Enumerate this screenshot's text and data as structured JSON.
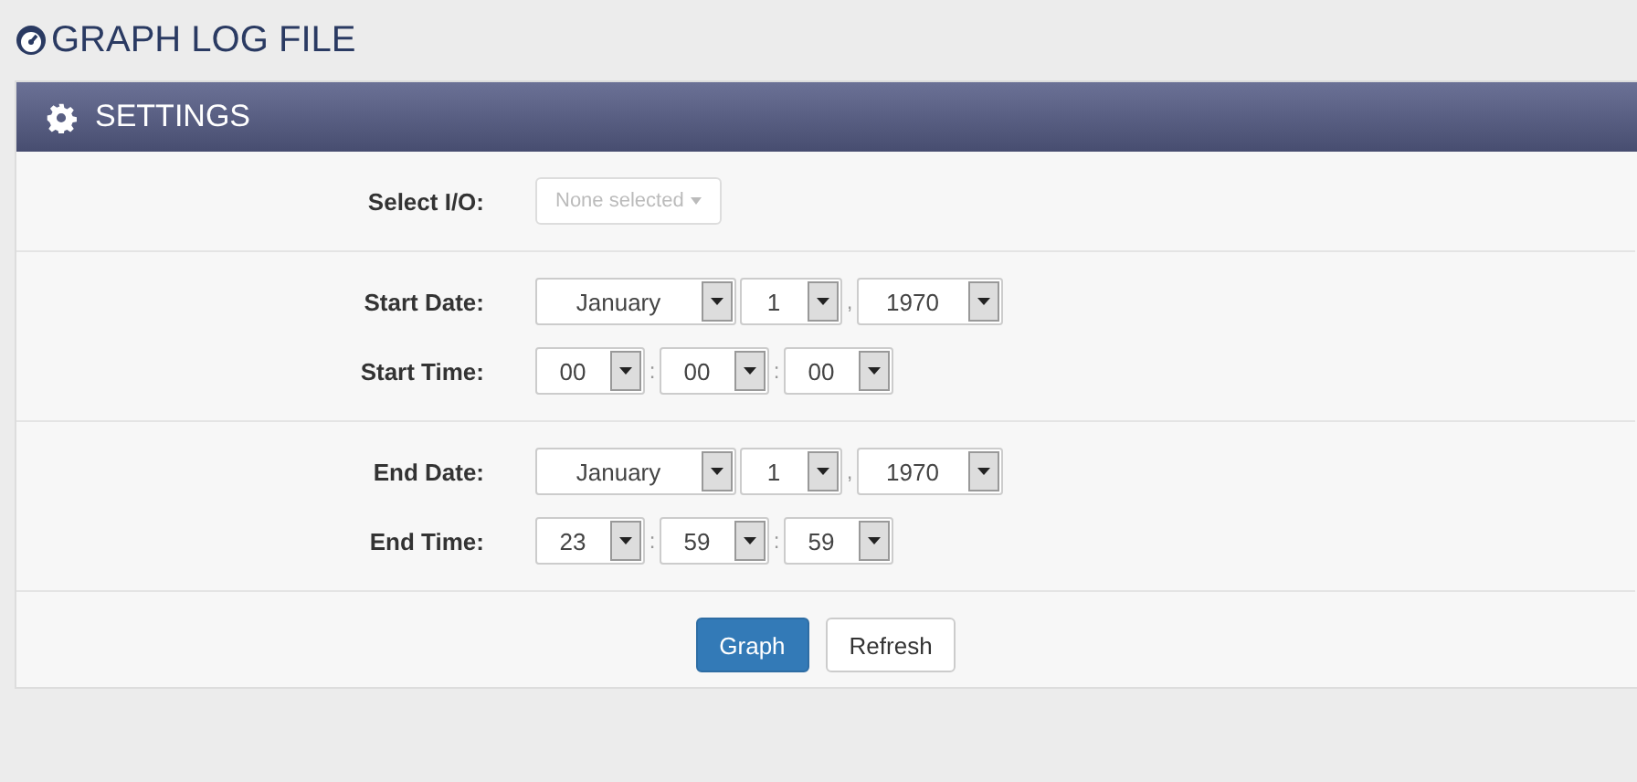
{
  "page_title": "GRAPH LOG FILE",
  "panel": {
    "title": "SETTINGS"
  },
  "sections": [
    {
      "rows": [
        {
          "label": "Select I/O:",
          "kind": "multiselect",
          "placeholder": "None selected",
          "disabled": true
        }
      ]
    },
    {
      "rows": [
        {
          "label": "Start Date:",
          "kind": "selects",
          "parts": [
            {
              "kind": "select",
              "text": "January"
            },
            {
              "kind": "select",
              "text": "1"
            },
            {
              "kind": "separator",
              "text": ","
            },
            {
              "kind": "select",
              "text": "1970"
            }
          ]
        },
        {
          "label": "Start Time:",
          "kind": "selects",
          "parts": [
            {
              "kind": "select",
              "text": "00"
            },
            {
              "kind": "separator",
              "text": ":"
            },
            {
              "kind": "select",
              "text": "00"
            },
            {
              "kind": "separator",
              "text": ":"
            },
            {
              "kind": "select",
              "text": "00"
            }
          ]
        }
      ]
    },
    {
      "rows": [
        {
          "label": "End Date:",
          "kind": "selects",
          "parts": [
            {
              "kind": "select",
              "text": "January"
            },
            {
              "kind": "select",
              "text": "1"
            },
            {
              "kind": "separator",
              "text": ","
            },
            {
              "kind": "select",
              "text": "1970"
            }
          ]
        },
        {
          "label": "End Time:",
          "kind": "selects",
          "parts": [
            {
              "kind": "select",
              "text": "23"
            },
            {
              "kind": "separator",
              "text": ":"
            },
            {
              "kind": "select",
              "text": "59"
            },
            {
              "kind": "separator",
              "text": ":"
            },
            {
              "kind": "select",
              "text": "59"
            }
          ]
        }
      ]
    }
  ],
  "buttons": [
    {
      "label": "Graph",
      "kind": "primary"
    },
    {
      "label": "Refresh",
      "kind": "default"
    }
  ]
}
